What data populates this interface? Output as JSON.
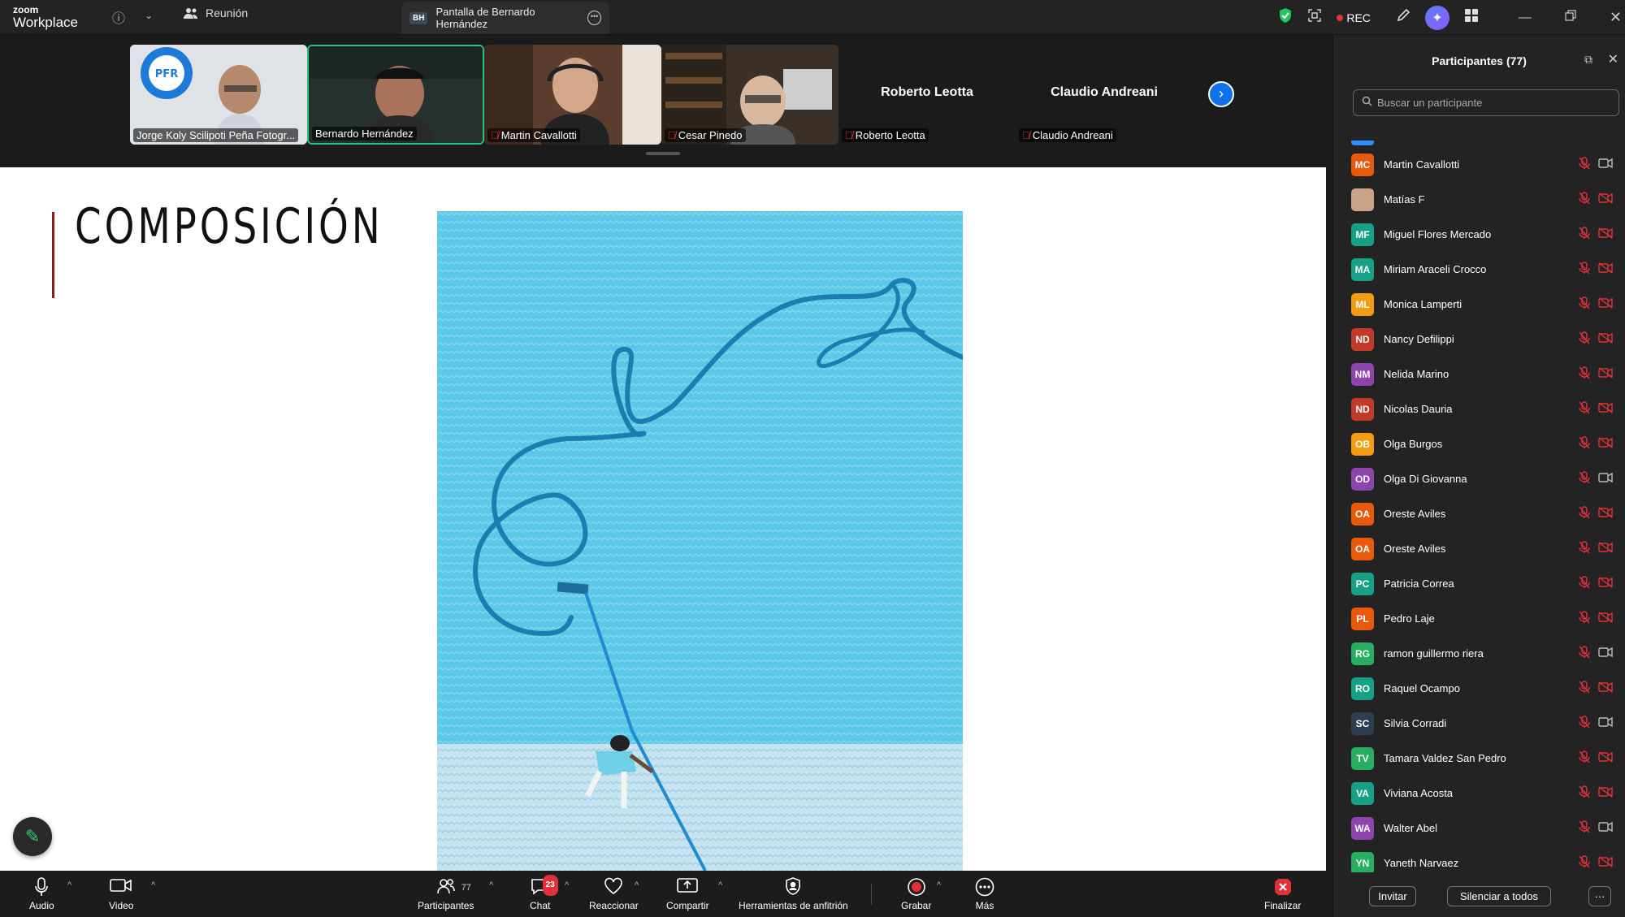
{
  "app": {
    "logo_line1": "zoom",
    "logo_line2": "Workplace",
    "meeting_label": "Reunión",
    "share_badge": "BH",
    "share_label": "Pantalla de Bernardo Hernández",
    "rec_label": "REC"
  },
  "strip": {
    "tiles": [
      {
        "name": "Jorge Koly Scilipoti Peña Fotogr...",
        "muted": false,
        "bg": "#d9dde2",
        "avatar_text": "PFR"
      },
      {
        "name": "Bernardo Hernández",
        "muted": false,
        "bg": "#26302c",
        "active": true
      },
      {
        "name": "Martin Cavallotti",
        "muted": true,
        "bg": "#4b3528"
      },
      {
        "name": "Cesar Pinedo",
        "muted": true,
        "bg": "#3a3027"
      },
      {
        "name": "Roberto Leotta",
        "muted": true,
        "big_name": "Roberto Leotta"
      },
      {
        "name": "Claudio Andreani",
        "muted": true,
        "big_name": "Claudio Andreani"
      }
    ]
  },
  "slide": {
    "title": "COMPOSICIÓN"
  },
  "toolbar": {
    "audio": "Audio",
    "video": "Video",
    "participants": "Participantes",
    "participants_count": "77",
    "chat": "Chat",
    "chat_badge": "23",
    "react": "Reaccionar",
    "share": "Compartir",
    "host_tools": "Herramientas de anfitrión",
    "record": "Grabar",
    "more": "Más",
    "end": "Finalizar"
  },
  "panel": {
    "title": "Participantes (77)",
    "search_placeholder": "Buscar un participante",
    "invite": "Invitar",
    "mute_all": "Silenciar a todos",
    "more": "···",
    "participants": [
      {
        "initials": "MC",
        "name": "Martin Cavallotti",
        "color": "#e8590c",
        "cam_off": false
      },
      {
        "initials": "",
        "name": "Matías F",
        "color": "#c9a28a",
        "cam_off": true
      },
      {
        "initials": "MF",
        "name": "Miguel Flores Mercado",
        "color": "#16a085",
        "cam_off": true
      },
      {
        "initials": "MA",
        "name": "Miriam Araceli Crocco",
        "color": "#16a085",
        "cam_off": true
      },
      {
        "initials": "ML",
        "name": "Monica Lamperti",
        "color": "#f39c12",
        "cam_off": true
      },
      {
        "initials": "ND",
        "name": "Nancy Defilippi",
        "color": "#c0392b",
        "cam_off": true
      },
      {
        "initials": "NM",
        "name": "Nelida Marino",
        "color": "#8e44ad",
        "cam_off": true
      },
      {
        "initials": "ND",
        "name": "Nicolas Dauria",
        "color": "#c0392b",
        "cam_off": true
      },
      {
        "initials": "OB",
        "name": "Olga Burgos",
        "color": "#f39c12",
        "cam_off": true
      },
      {
        "initials": "OD",
        "name": "Olga Di Giovanna",
        "color": "#8e44ad",
        "cam_off": false
      },
      {
        "initials": "OA",
        "name": "Oreste Aviles",
        "color": "#e8590c",
        "cam_off": true
      },
      {
        "initials": "OA",
        "name": "Oreste Aviles",
        "color": "#e8590c",
        "cam_off": true
      },
      {
        "initials": "PC",
        "name": "Patricia Correa",
        "color": "#16a085",
        "cam_off": true
      },
      {
        "initials": "PL",
        "name": "Pedro Laje",
        "color": "#e8590c",
        "cam_off": true
      },
      {
        "initials": "RG",
        "name": "ramon guillermo riera",
        "color": "#27ae60",
        "cam_off": false
      },
      {
        "initials": "RO",
        "name": "Raquel Ocampo",
        "color": "#16a085",
        "cam_off": true
      },
      {
        "initials": "SC",
        "name": "Silvia Corradi",
        "color": "#2c3e50",
        "cam_off": false
      },
      {
        "initials": "TV",
        "name": "Tamara Valdez San Pedro",
        "color": "#27ae60",
        "cam_off": true
      },
      {
        "initials": "VA",
        "name": "Viviana Acosta",
        "color": "#16a085",
        "cam_off": true
      },
      {
        "initials": "WA",
        "name": "Walter Abel",
        "color": "#8e44ad",
        "cam_off": false
      },
      {
        "initials": "YN",
        "name": "Yaneth Narvaez",
        "color": "#27ae60",
        "cam_off": true
      }
    ]
  }
}
